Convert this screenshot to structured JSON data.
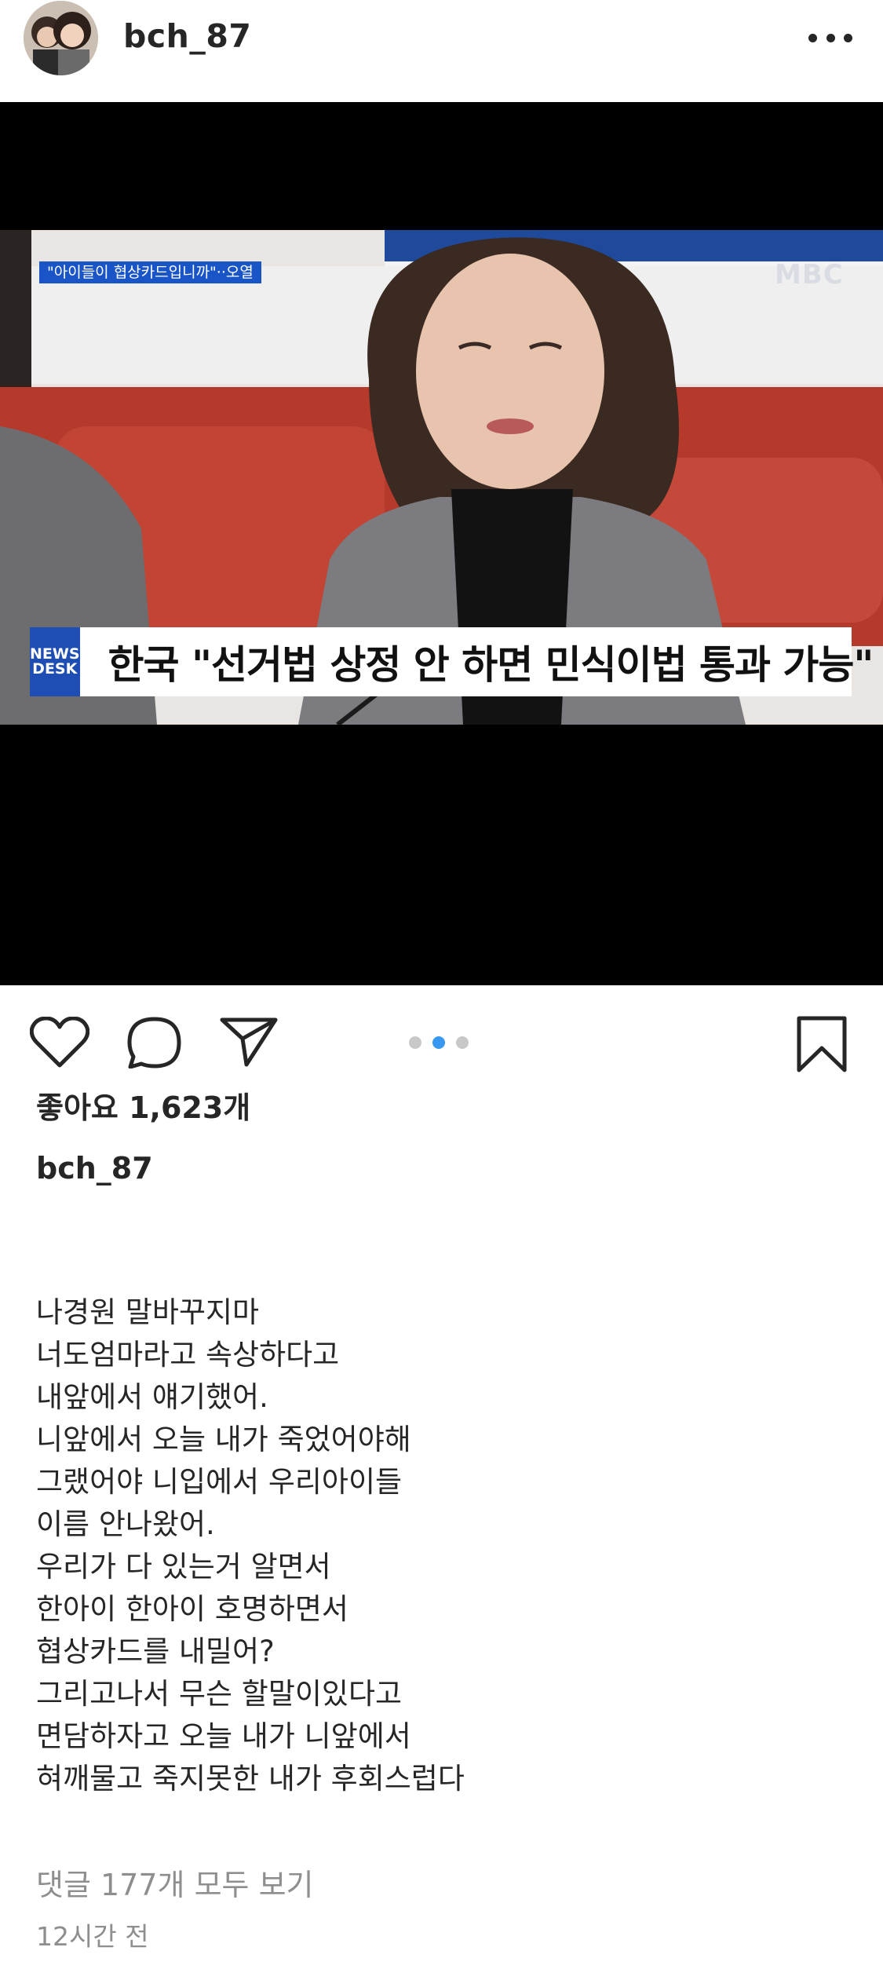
{
  "post": {
    "username": "bch_87",
    "avatar_icon": "profile-photo-avatar",
    "more_icon": "more-options-icon"
  },
  "media": {
    "carousel": {
      "count": 3,
      "active_index": 1
    },
    "video_frame": {
      "top_chip": "\"아이들이 협상카드입니까\"··오열",
      "channel_logo": "MBC",
      "lower_third_logo_line1": "NEWS",
      "lower_third_logo_line2": "DESK",
      "lower_third_text": "한국 \"선거법 상정 안 하면 민식이법 통과 가능\""
    }
  },
  "actions": {
    "like_icon": "heart-icon",
    "comment_icon": "comment-bubble-icon",
    "share_icon": "paper-plane-icon",
    "save_icon": "bookmark-icon"
  },
  "likes": "좋아요 1,623개",
  "caption": {
    "username": "bch_87",
    "lines": [
      "나경원 말바꾸지마",
      "너도엄마라고 속상하다고",
      "내앞에서 얘기했어.",
      "니앞에서 오늘 내가 죽었어야해",
      "그랬어야 니입에서 우리아이들",
      "이름 안나왔어.",
      "우리가 다 있는거 알면서",
      "한아이 한아이 호명하면서",
      "협상카드를 내밀어?",
      "그리고나서 무슨 할말이있다고",
      "면담하자고 오늘 내가 니앞에서",
      "혀깨물고 죽지못한 내가 후회스럽다"
    ]
  },
  "view_comments": "댓글 177개 모두 보기",
  "timestamp": "12시간 전",
  "colors": {
    "accent_dot": "#3897f0",
    "muted_text": "#8e8e8e",
    "text": "#262626"
  }
}
